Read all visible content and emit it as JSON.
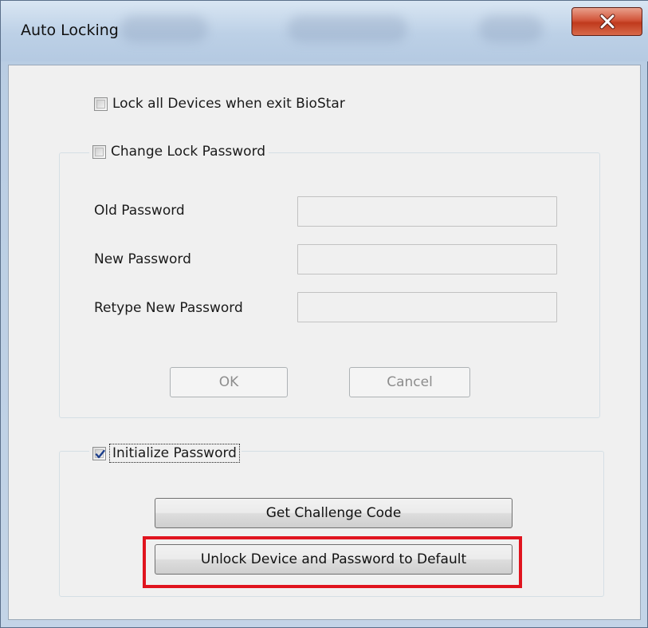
{
  "window": {
    "title": "Auto Locking"
  },
  "lock_all": {
    "label": "Lock all Devices when exit BioStar",
    "checked": false
  },
  "change_password": {
    "label": "Change Lock Password",
    "checked": false,
    "old_password_label": "Old Password",
    "new_password_label": "New Password",
    "retype_password_label": "Retype New Password",
    "old_password_value": "",
    "new_password_value": "",
    "retype_password_value": "",
    "ok_label": "OK",
    "cancel_label": "Cancel"
  },
  "initialize_password": {
    "label": "Initialize Password",
    "checked": true,
    "get_challenge_label": "Get Challenge Code",
    "unlock_label": "Unlock Device and Password to Default"
  },
  "colors": {
    "highlight": "#e0141e",
    "close_button": "#c8452a"
  },
  "icons": {
    "close": "close-icon",
    "check": "checkmark-icon"
  }
}
